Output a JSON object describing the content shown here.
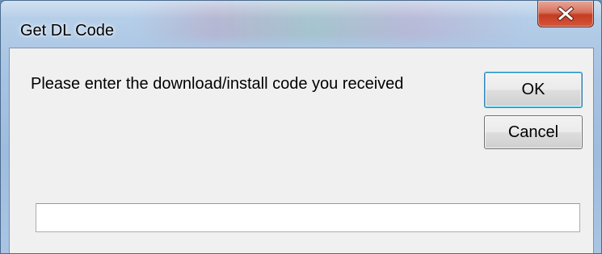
{
  "window": {
    "title": "Get DL Code",
    "close_icon": "close-icon"
  },
  "dialog": {
    "prompt": "Please enter the download/install code you received",
    "ok_label": "OK",
    "cancel_label": "Cancel",
    "code_input": {
      "value": "",
      "placeholder": ""
    }
  }
}
